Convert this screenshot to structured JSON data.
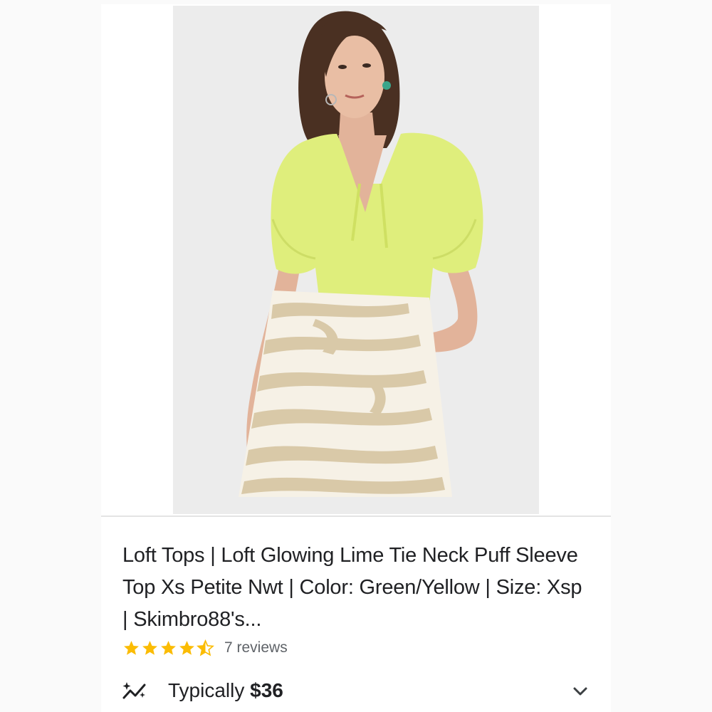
{
  "product": {
    "title": "Loft Tops | Loft Glowing Lime Tie Neck Puff Sleeve Top Xs Petite Nwt | Color: Green/Yellow | Size: Xsp | Skimbro88's...",
    "image_icon": "product-photo-model-lime-top-zebra-skirt",
    "rating": 4.5,
    "rating_max": 5,
    "reviews_label": "7 reviews",
    "price_prefix": "Typically",
    "price_value": "$36",
    "trend_icon": "price-trend-sparkle-icon",
    "expand_icon": "chevron-down-icon"
  },
  "colors": {
    "star": "#fbbc04",
    "star_empty": "#dadce0",
    "text": "#202124",
    "muted": "#5f6368",
    "top_lime": "#dfee7c",
    "skirt_beige": "#d9c9a8"
  }
}
